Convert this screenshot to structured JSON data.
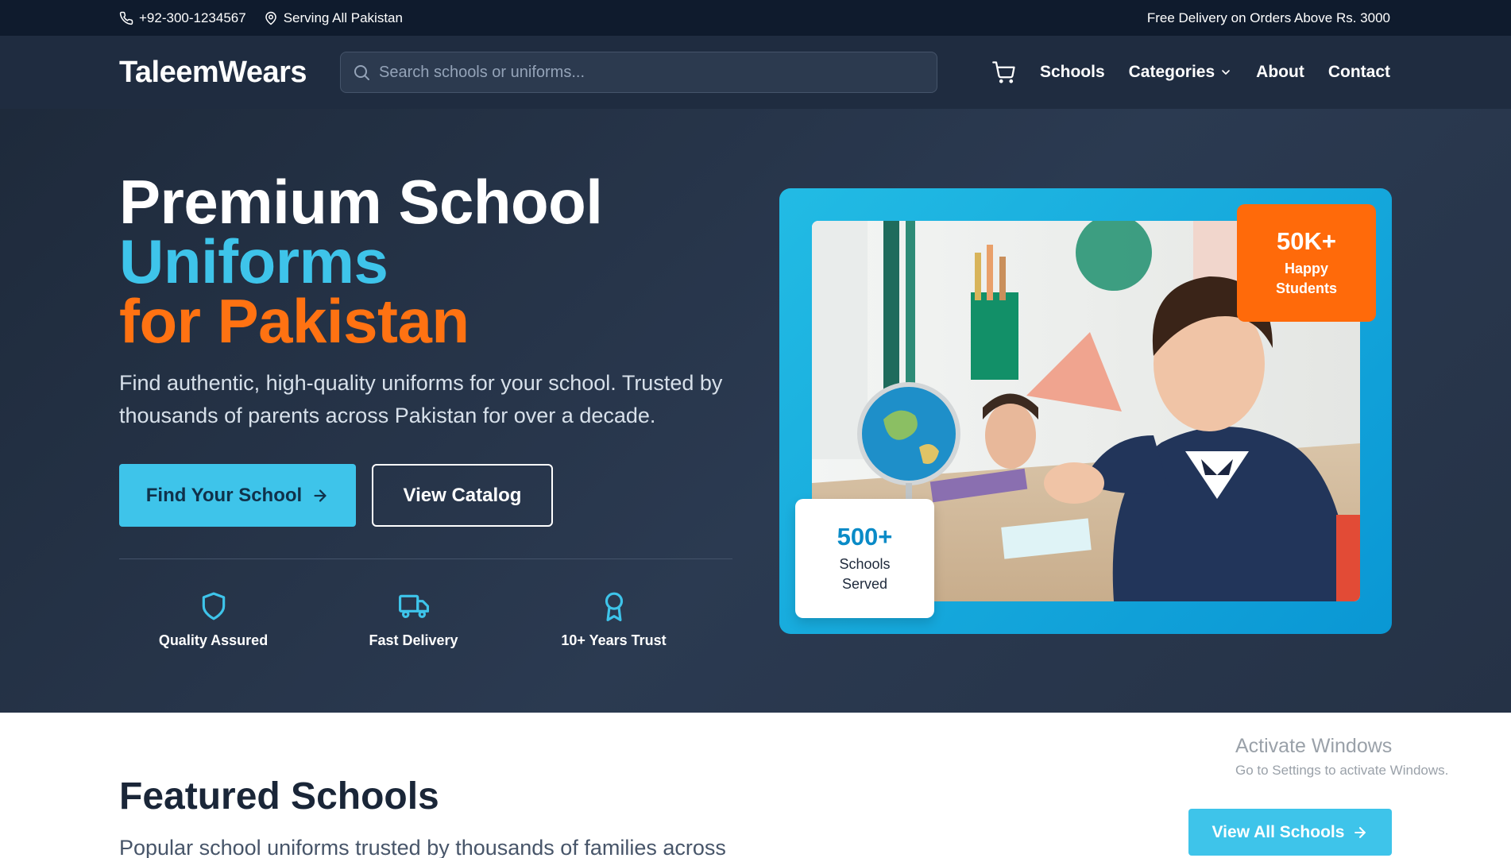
{
  "topbar": {
    "phone": "+92-300-1234567",
    "location": "Serving All Pakistan",
    "promo": "Free Delivery on Orders Above Rs. 3000"
  },
  "navbar": {
    "logo": "TaleemWears",
    "search_placeholder": "Search schools or uniforms...",
    "links": {
      "schools": "Schools",
      "categories": "Categories",
      "about": "About",
      "contact": "Contact"
    }
  },
  "hero": {
    "title_line1": "Premium School",
    "title_line2": "Uniforms",
    "title_line3": "for Pakistan",
    "description": "Find authentic, high-quality uniforms for your school. Trusted by thousands of parents across Pakistan for over a decade.",
    "primary_button": "Find Your School",
    "secondary_button": "View Catalog",
    "features": [
      {
        "label": "Quality Assured",
        "icon": "shield-icon"
      },
      {
        "label": "Fast Delivery",
        "icon": "truck-icon"
      },
      {
        "label": "10+ Years Trust",
        "icon": "award-icon"
      }
    ],
    "stat_students": {
      "value": "50K+",
      "label": "Happy Students"
    },
    "stat_schools": {
      "value": "500+",
      "label": "Schools Served"
    }
  },
  "featured": {
    "title": "Featured Schools",
    "subtitle": "Popular school uniforms trusted by thousands of families across",
    "view_all": "View All Schools"
  },
  "watermark": {
    "line1": "Activate Windows",
    "line2": "Go to Settings to activate Windows."
  },
  "colors": {
    "accent_blue": "#3ec4ea",
    "accent_orange": "#ff7212",
    "dark_bg": "#0f1b2d"
  }
}
